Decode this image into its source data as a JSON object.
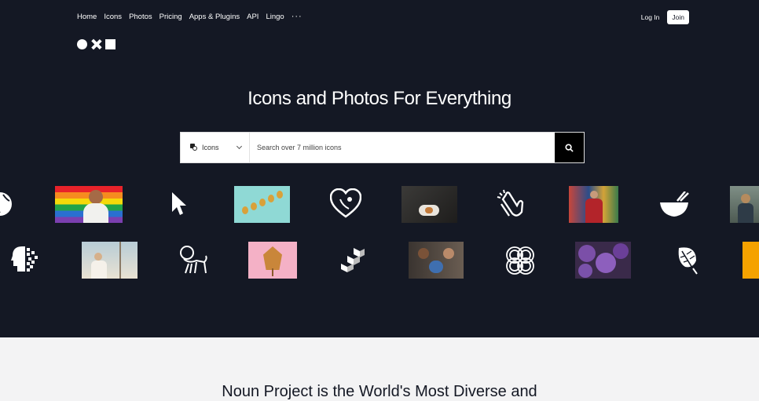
{
  "nav": {
    "items": [
      "Home",
      "Icons",
      "Photos",
      "Pricing",
      "Apps & Plugins",
      "API",
      "Lingo"
    ],
    "more": "···",
    "login": "Log In",
    "join": "Join"
  },
  "hero": {
    "title": "Icons and Photos For Everything"
  },
  "search": {
    "type_selected": "Icons",
    "placeholder": "Search over 7 million icons"
  },
  "section": {
    "title": "Noun Project is the World's Most Diverse and"
  },
  "colors": {
    "hero_bg": "#141824",
    "page_bg": "#f3f3f4",
    "accent_orange": "#f5a200"
  },
  "gallery_icons": [
    "globe-icon",
    "cursor-icon",
    "heart-face-icon",
    "clapping-hands-icon",
    "bowl-chopsticks-icon",
    "pixel-head-icon",
    "lion-icon",
    "isometric-blocks-icon",
    "circles-pattern-icon",
    "leaf-icon"
  ]
}
